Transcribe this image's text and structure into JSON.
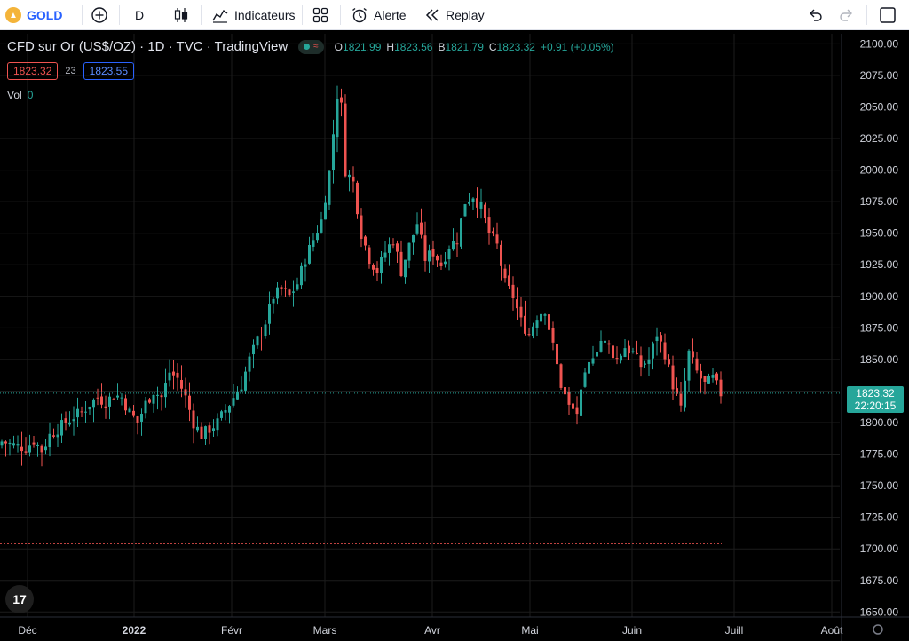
{
  "toolbar": {
    "symbol": "GOLD",
    "interval": "D",
    "indicators": "Indicateurs",
    "alert": "Alerte",
    "replay": "Replay"
  },
  "legend": {
    "title": "CFD sur Or (US$/OZ) · 1D · TVC · TradingView",
    "open_label": "O",
    "open": "1821.99",
    "high_label": "H",
    "high": "1823.56",
    "low_label": "B",
    "low": "1821.79",
    "close_label": "C",
    "close": "1823.32",
    "change": "+0.91 (+0.05%)"
  },
  "trade": {
    "sell": "1823.32",
    "spread": "23",
    "buy": "1823.55"
  },
  "volume": {
    "label": "Vol",
    "value": "0"
  },
  "last_price": {
    "value": "1823.32",
    "countdown": "22:20:15"
  },
  "colors": {
    "up": "#26a69a",
    "down": "#ef5350",
    "background": "#000000",
    "grid": "#1c1c1c",
    "axis_text": "#d1d4dc"
  },
  "chart_data": {
    "type": "candlestick",
    "y_ticks": [
      "2100.00",
      "2075.00",
      "2050.00",
      "2025.00",
      "2000.00",
      "1975.00",
      "1950.00",
      "1925.00",
      "1900.00",
      "1875.00",
      "1850.00",
      "1825.00",
      "1800.00",
      "1775.00",
      "1750.00",
      "1725.00",
      "1700.00",
      "1675.00",
      "1650.00"
    ],
    "ylim": [
      1646,
      2108
    ],
    "x_ticks": [
      "Déc",
      "2022",
      "Févr",
      "Mars",
      "Avr",
      "Mai",
      "Juin",
      "Juill",
      "Août"
    ],
    "last_price": 1823.32,
    "reference_line": 1704,
    "close_path": [
      [
        0,
        1785
      ],
      [
        3,
        1782
      ],
      [
        6,
        1780
      ],
      [
        8,
        1786
      ],
      [
        10,
        1778
      ],
      [
        12,
        1790
      ],
      [
        14,
        1795
      ],
      [
        16,
        1800
      ],
      [
        18,
        1805
      ],
      [
        20,
        1808
      ],
      [
        22,
        1815
      ],
      [
        24,
        1820
      ],
      [
        26,
        1816
      ],
      [
        28,
        1822
      ],
      [
        30,
        1820
      ],
      [
        32,
        1808
      ],
      [
        34,
        1800
      ],
      [
        36,
        1815
      ],
      [
        38,
        1825
      ],
      [
        40,
        1820
      ],
      [
        42,
        1840
      ],
      [
        44,
        1835
      ],
      [
        46,
        1820
      ],
      [
        48,
        1800
      ],
      [
        50,
        1790
      ],
      [
        52,
        1795
      ],
      [
        54,
        1800
      ],
      [
        56,
        1810
      ],
      [
        58,
        1820
      ],
      [
        60,
        1830
      ],
      [
        62,
        1850
      ],
      [
        64,
        1865
      ],
      [
        66,
        1880
      ],
      [
        68,
        1900
      ],
      [
        70,
        1905
      ],
      [
        72,
        1900
      ],
      [
        74,
        1910
      ],
      [
        76,
        1930
      ],
      [
        78,
        1945
      ],
      [
        80,
        1960
      ],
      [
        82,
        1998
      ],
      [
        84,
        2060
      ],
      [
        85,
        2050
      ],
      [
        86,
        2000
      ],
      [
        88,
        1990
      ],
      [
        90,
        1950
      ],
      [
        92,
        1930
      ],
      [
        94,
        1920
      ],
      [
        96,
        1935
      ],
      [
        98,
        1945
      ],
      [
        100,
        1920
      ],
      [
        102,
        1940
      ],
      [
        104,
        1958
      ],
      [
        106,
        1930
      ],
      [
        108,
        1935
      ],
      [
        110,
        1925
      ],
      [
        112,
        1940
      ],
      [
        114,
        1945
      ],
      [
        116,
        1975
      ],
      [
        118,
        1980
      ],
      [
        120,
        1970
      ],
      [
        122,
        1950
      ],
      [
        124,
        1940
      ],
      [
        126,
        1910
      ],
      [
        128,
        1900
      ],
      [
        130,
        1880
      ],
      [
        132,
        1870
      ],
      [
        134,
        1885
      ],
      [
        136,
        1890
      ],
      [
        138,
        1860
      ],
      [
        140,
        1830
      ],
      [
        142,
        1812
      ],
      [
        144,
        1808
      ],
      [
        146,
        1835
      ],
      [
        148,
        1855
      ],
      [
        150,
        1865
      ],
      [
        152,
        1860
      ],
      [
        154,
        1850
      ],
      [
        156,
        1860
      ],
      [
        158,
        1855
      ],
      [
        160,
        1845
      ],
      [
        162,
        1850
      ],
      [
        164,
        1870
      ],
      [
        166,
        1855
      ],
      [
        168,
        1830
      ],
      [
        170,
        1810
      ],
      [
        172,
        1855
      ],
      [
        174,
        1840
      ],
      [
        176,
        1830
      ],
      [
        178,
        1835
      ],
      [
        180,
        1823
      ]
    ]
  }
}
